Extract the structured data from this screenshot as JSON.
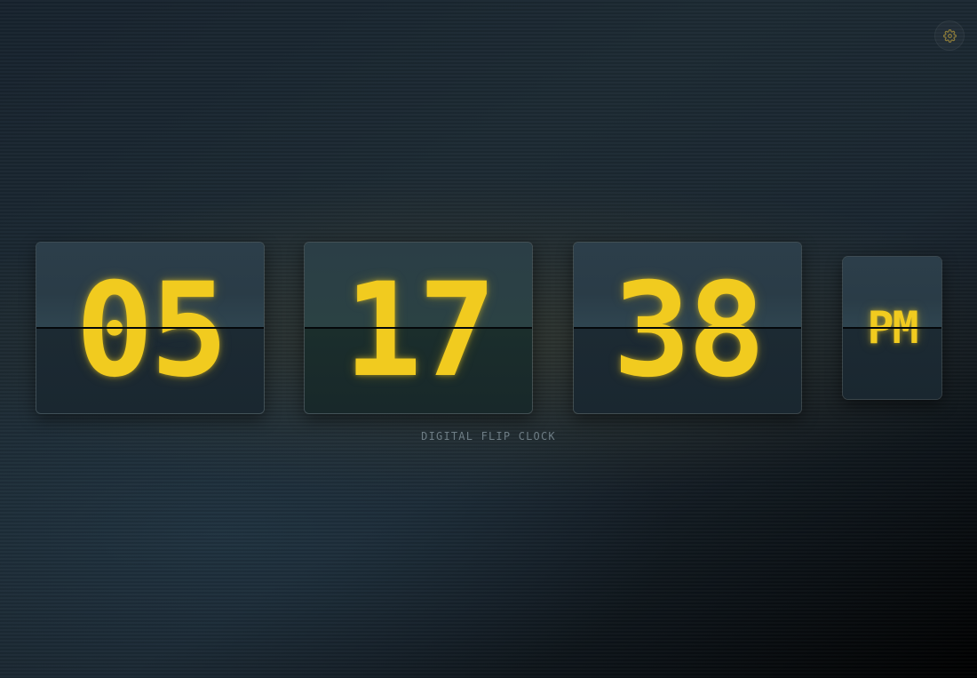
{
  "clock": {
    "hours": "05",
    "minutes": "17",
    "seconds": "38",
    "period": "PM"
  },
  "caption": "DIGITAL FLIP CLOCK",
  "toolbar": {
    "settings_icon": "gear-icon"
  },
  "colors": {
    "digit": "#f1cb1f",
    "caption": "#6e7d85",
    "background_dark": "#0a0f13"
  }
}
